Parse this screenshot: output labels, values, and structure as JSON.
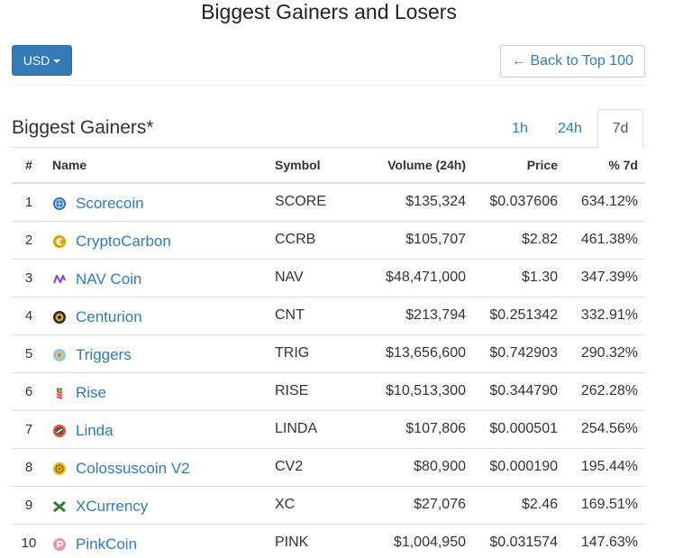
{
  "page": {
    "title": "Biggest Gainers and Losers"
  },
  "toolbar": {
    "currency_label": "USD",
    "back_label": "← Back to Top 100"
  },
  "section": {
    "title": "Biggest Gainers*"
  },
  "tabs": [
    {
      "label": "1h",
      "active": false
    },
    {
      "label": "24h",
      "active": false
    },
    {
      "label": "7d",
      "active": true
    }
  ],
  "table": {
    "headers": {
      "rank": "#",
      "name": "Name",
      "symbol": "Symbol",
      "volume": "Volume (24h)",
      "price": "Price",
      "change": "% 7d"
    },
    "rows": [
      {
        "rank": "1",
        "name": "Scorecoin",
        "symbol": "SCORE",
        "volume": "$135,324",
        "price": "$0.037606",
        "change": "634.12%",
        "icon": "scorecoin-icon"
      },
      {
        "rank": "2",
        "name": "CryptoCarbon",
        "symbol": "CCRB",
        "volume": "$105,707",
        "price": "$2.82",
        "change": "461.38%",
        "icon": "cryptocarbon-icon"
      },
      {
        "rank": "3",
        "name": "NAV Coin",
        "symbol": "NAV",
        "volume": "$48,471,000",
        "price": "$1.30",
        "change": "347.39%",
        "icon": "navcoin-icon"
      },
      {
        "rank": "4",
        "name": "Centurion",
        "symbol": "CNT",
        "volume": "$213,794",
        "price": "$0.251342",
        "change": "332.91%",
        "icon": "centurion-icon"
      },
      {
        "rank": "5",
        "name": "Triggers",
        "symbol": "TRIG",
        "volume": "$13,656,600",
        "price": "$0.742903",
        "change": "290.32%",
        "icon": "triggers-icon"
      },
      {
        "rank": "6",
        "name": "Rise",
        "symbol": "RISE",
        "volume": "$10,513,300",
        "price": "$0.344790",
        "change": "262.28%",
        "icon": "rise-icon"
      },
      {
        "rank": "7",
        "name": "Linda",
        "symbol": "LINDA",
        "volume": "$107,806",
        "price": "$0.000501",
        "change": "254.56%",
        "icon": "linda-icon"
      },
      {
        "rank": "8",
        "name": "Colossuscoin V2",
        "symbol": "CV2",
        "volume": "$80,900",
        "price": "$0.000190",
        "change": "195.44%",
        "icon": "colossuscoin-icon"
      },
      {
        "rank": "9",
        "name": "XCurrency",
        "symbol": "XC",
        "volume": "$27,076",
        "price": "$2.46",
        "change": "169.51%",
        "icon": "xcurrency-icon"
      },
      {
        "rank": "10",
        "name": "PinkCoin",
        "symbol": "PINK",
        "volume": "$1,004,950",
        "price": "$0.031574",
        "change": "147.63%",
        "icon": "pinkcoin-icon"
      }
    ]
  },
  "colors": {
    "primary": "#337ab7",
    "positive": "#3c9a3c",
    "border": "#dddddd"
  }
}
